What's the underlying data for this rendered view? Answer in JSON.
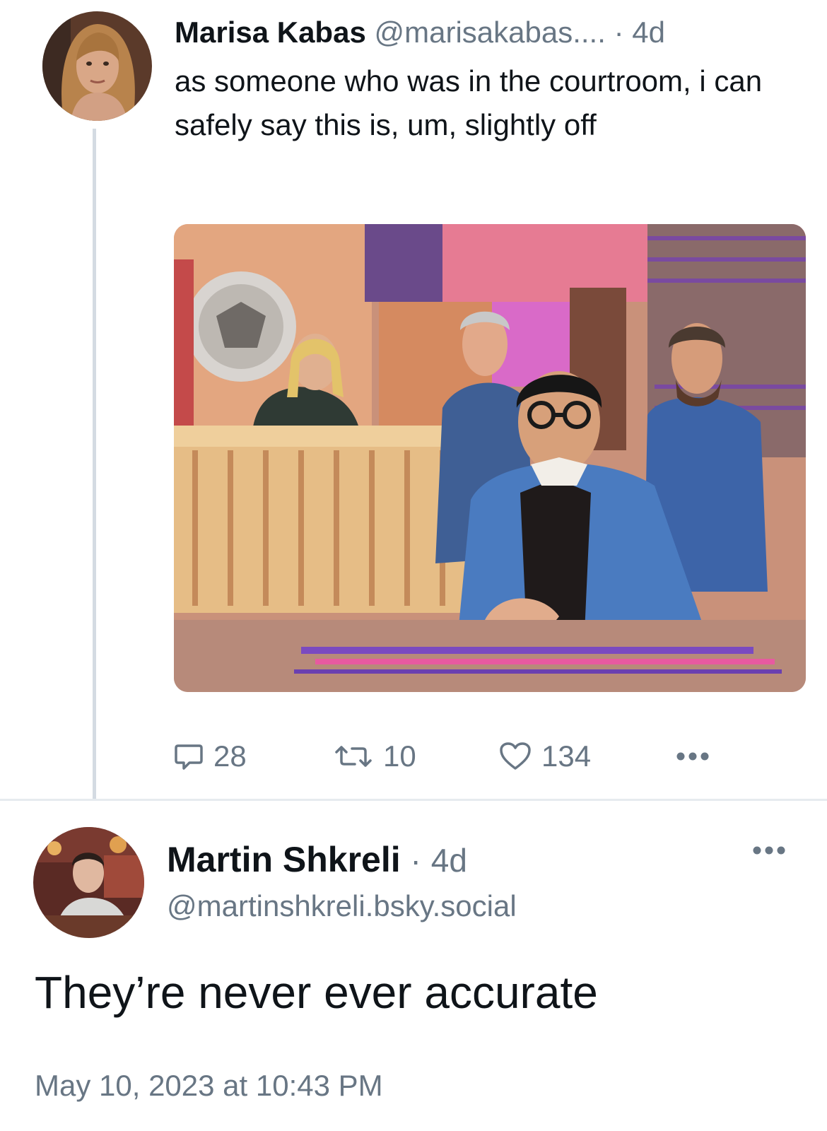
{
  "parent_post": {
    "author": {
      "display_name": "Marisa Kabas",
      "handle": "@marisakabas....",
      "separator": "·",
      "age": "4d"
    },
    "text": "as someone who was in the courtroom, i can safely say this is, um, slightly off",
    "image": {
      "kind": "courtroom sketch"
    },
    "actions": {
      "reply_count": "28",
      "repost_count": "10",
      "like_count": "134"
    }
  },
  "focused_post": {
    "author": {
      "display_name": "Martin Shkreli",
      "handle": "@martinshkreli.bsky.social",
      "separator": "·",
      "age": "4d"
    },
    "text": "They’re never ever accurate",
    "timestamp": "May 10, 2023 at 10:43 PM"
  },
  "icons": {
    "reply": "speech-bubble-icon",
    "repost": "repost-arrows-icon",
    "like": "heart-icon",
    "more": "ellipsis-icon"
  },
  "colors": {
    "text": "#0f1419",
    "muted": "#687684",
    "thread_line": "#d4dbe2",
    "divider": "#e6ebef"
  }
}
